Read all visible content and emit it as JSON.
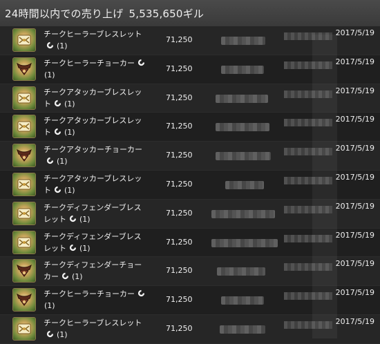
{
  "header": {
    "title": "24時間以内での売り上げ",
    "amount": "5,535,650ギル"
  },
  "colors": {
    "background": "#202020",
    "header": "#3f3f3f",
    "text": "#f0f0f0"
  },
  "rows": [
    {
      "icon": "bracelet-icon",
      "name": "チークヒーラーブレスレット",
      "qty": "(1)",
      "price": "71,250",
      "date": "2017/5/19"
    },
    {
      "icon": "choker-icon",
      "name": "チークヒーラーチョーカー",
      "qty": "(1)",
      "price": "71,250",
      "date": "2017/5/19"
    },
    {
      "icon": "bracelet-icon",
      "name": "チークアタッカーブレスレット",
      "qty": "(1)",
      "price": "71,250",
      "date": "2017/5/19"
    },
    {
      "icon": "bracelet-icon",
      "name": "チークアタッカーブレスレット",
      "qty": "(1)",
      "price": "71,250",
      "date": "2017/5/19"
    },
    {
      "icon": "choker-icon",
      "name": "チークアタッカーチョーカー",
      "qty": "(1)",
      "price": "71,250",
      "date": "2017/5/19"
    },
    {
      "icon": "bracelet-icon",
      "name": "チークアタッカーブレスレット",
      "qty": "(1)",
      "price": "71,250",
      "date": "2017/5/19"
    },
    {
      "icon": "bracelet-icon",
      "name": "チークディフェンダーブレスレット",
      "qty": "(1)",
      "price": "71,250",
      "date": "2017/5/19"
    },
    {
      "icon": "bracelet-icon",
      "name": "チークディフェンダーブレスレット",
      "qty": "(1)",
      "price": "71,250",
      "date": "2017/5/19"
    },
    {
      "icon": "choker-icon",
      "name": "チークディフェンダーチョーカー",
      "qty": "(1)",
      "price": "71,250",
      "date": "2017/5/19"
    },
    {
      "icon": "choker-icon",
      "name": "チークヒーラーチョーカー",
      "qty": "(1)",
      "price": "71,250",
      "date": "2017/5/19"
    },
    {
      "icon": "bracelet-icon",
      "name": "チークヒーラーブレスレット",
      "qty": "(1)",
      "price": "71,250",
      "date": "2017/5/19"
    }
  ]
}
